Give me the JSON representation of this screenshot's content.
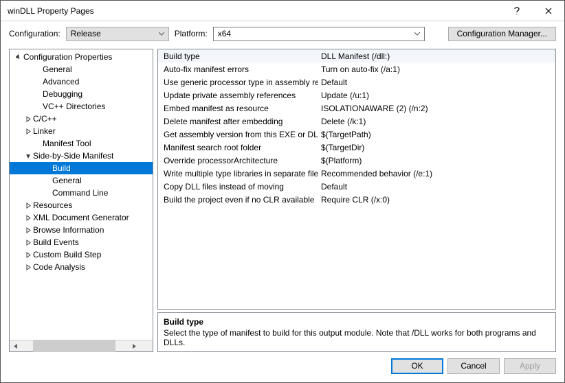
{
  "title": "winDLL Property Pages",
  "configbar": {
    "configuration_label": "Configuration:",
    "configuration_value": "Release",
    "platform_label": "Platform:",
    "platform_value": "x64",
    "cfgmgr_label": "Configuration Manager..."
  },
  "tree": {
    "root": "Configuration Properties",
    "items": [
      {
        "label": "General",
        "indent": 34,
        "exp": null
      },
      {
        "label": "Advanced",
        "indent": 34,
        "exp": null
      },
      {
        "label": "Debugging",
        "indent": 34,
        "exp": null
      },
      {
        "label": "VC++ Directories",
        "indent": 34,
        "exp": null
      },
      {
        "label": "C/C++",
        "indent": 20,
        "exp": "closed"
      },
      {
        "label": "Linker",
        "indent": 20,
        "exp": "closed"
      },
      {
        "label": "Manifest Tool",
        "indent": 34,
        "exp": null
      },
      {
        "label": "Side-by-Side Manifest",
        "indent": 20,
        "exp": "open"
      },
      {
        "label": "Build",
        "indent": 48,
        "exp": null,
        "selected": true
      },
      {
        "label": "General",
        "indent": 48,
        "exp": null
      },
      {
        "label": "Command Line",
        "indent": 48,
        "exp": null
      },
      {
        "label": "Resources",
        "indent": 20,
        "exp": "closed"
      },
      {
        "label": "XML Document Generator",
        "indent": 20,
        "exp": "closed"
      },
      {
        "label": "Browse Information",
        "indent": 20,
        "exp": "closed"
      },
      {
        "label": "Build Events",
        "indent": 20,
        "exp": "closed"
      },
      {
        "label": "Custom Build Step",
        "indent": 20,
        "exp": "closed"
      },
      {
        "label": "Code Analysis",
        "indent": 20,
        "exp": "closed"
      }
    ]
  },
  "grid": [
    {
      "name": "Build type",
      "value": "DLL Manifest (/dll:)",
      "selected": true
    },
    {
      "name": "Auto-fix manifest errors",
      "value": "Turn on auto-fix (/a:1)"
    },
    {
      "name": "Use generic processor type in assembly ref",
      "value": "Default"
    },
    {
      "name": "Update private assembly references",
      "value": "Update (/u:1)"
    },
    {
      "name": "Embed manifest as resource",
      "value": "ISOLATIONAWARE (2) (/n:2)"
    },
    {
      "name": "Delete manifest after embedding",
      "value": "Delete (/k:1)"
    },
    {
      "name": "Get assembly version from this EXE or DLL",
      "value": "$(TargetPath)"
    },
    {
      "name": "Manifest search root folder",
      "value": "$(TargetDir)"
    },
    {
      "name": "Override processorArchitecture",
      "value": "$(Platform)"
    },
    {
      "name": "Write multiple type libraries in separate file",
      "value": "Recommended behavior (/e:1)"
    },
    {
      "name": "Copy DLL files instead of moving",
      "value": "Default"
    },
    {
      "name": "Build the project even if no CLR available",
      "value": "Require CLR (/x:0)"
    }
  ],
  "desc": {
    "title": "Build type",
    "body": "Select the type of manifest to build for this output module. Note that /DLL works for both programs and DLLs."
  },
  "footer": {
    "ok": "OK",
    "cancel": "Cancel",
    "apply": "Apply"
  }
}
